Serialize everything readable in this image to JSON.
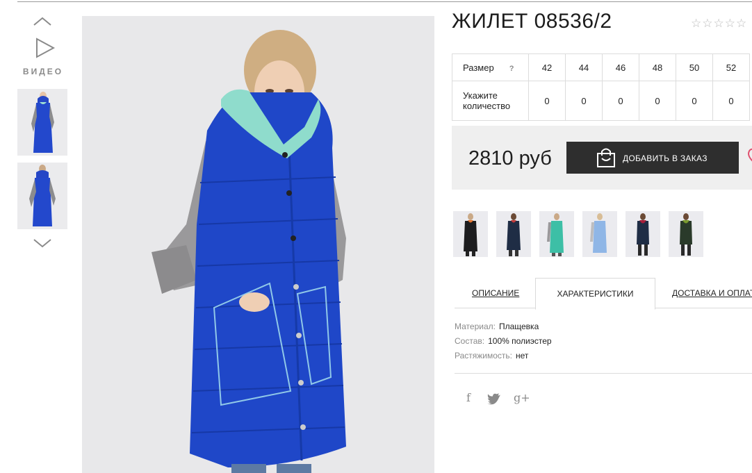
{
  "rail": {
    "video_label": "ВИДЕО",
    "up_arrow_icon": "chevron-up-icon",
    "down_arrow_icon": "chevron-down-icon",
    "play_icon": "play-icon"
  },
  "product": {
    "title": "ЖИЛЕТ 08536/2",
    "rating_stars": "☆☆☆☆☆",
    "rating_value": 0,
    "accent_color": "#1f47c8"
  },
  "size_table": {
    "size_label": "Размер",
    "help_mark": "?",
    "qty_label_line1": "Укажите",
    "qty_label_line2": "количество",
    "sizes": [
      "42",
      "44",
      "46",
      "48",
      "50",
      "52"
    ],
    "quantities": [
      "0",
      "0",
      "0",
      "0",
      "0",
      "0"
    ]
  },
  "purchase": {
    "price": "2810 руб",
    "add_button_label": "ДОБАВИТЬ В ЗАКАЗ",
    "cart_icon": "shopping-bag-icon",
    "wish_icon": "heart-icon"
  },
  "tabs": [
    {
      "label": "ОПИСАНИЕ",
      "active": false
    },
    {
      "label": "ХАРАКТЕРИСТИКИ",
      "active": true
    },
    {
      "label": "ДОСТАВКА И ОПЛАТА",
      "active": false
    }
  ],
  "specs": [
    {
      "key": "Материал:",
      "value": "Плащевка"
    },
    {
      "key": "Состав:",
      "value": "100% полиэстер"
    },
    {
      "key": "Растяжимость:",
      "value": "нет"
    }
  ],
  "social": {
    "facebook": "f",
    "twitter": "twitter-icon",
    "googleplus": "g+"
  },
  "colors": {
    "button_bg": "#2e2e2e",
    "price_box_bg": "#efefef",
    "vest_blue": "#1f47c8",
    "hood_lining": "#8fdccc"
  }
}
